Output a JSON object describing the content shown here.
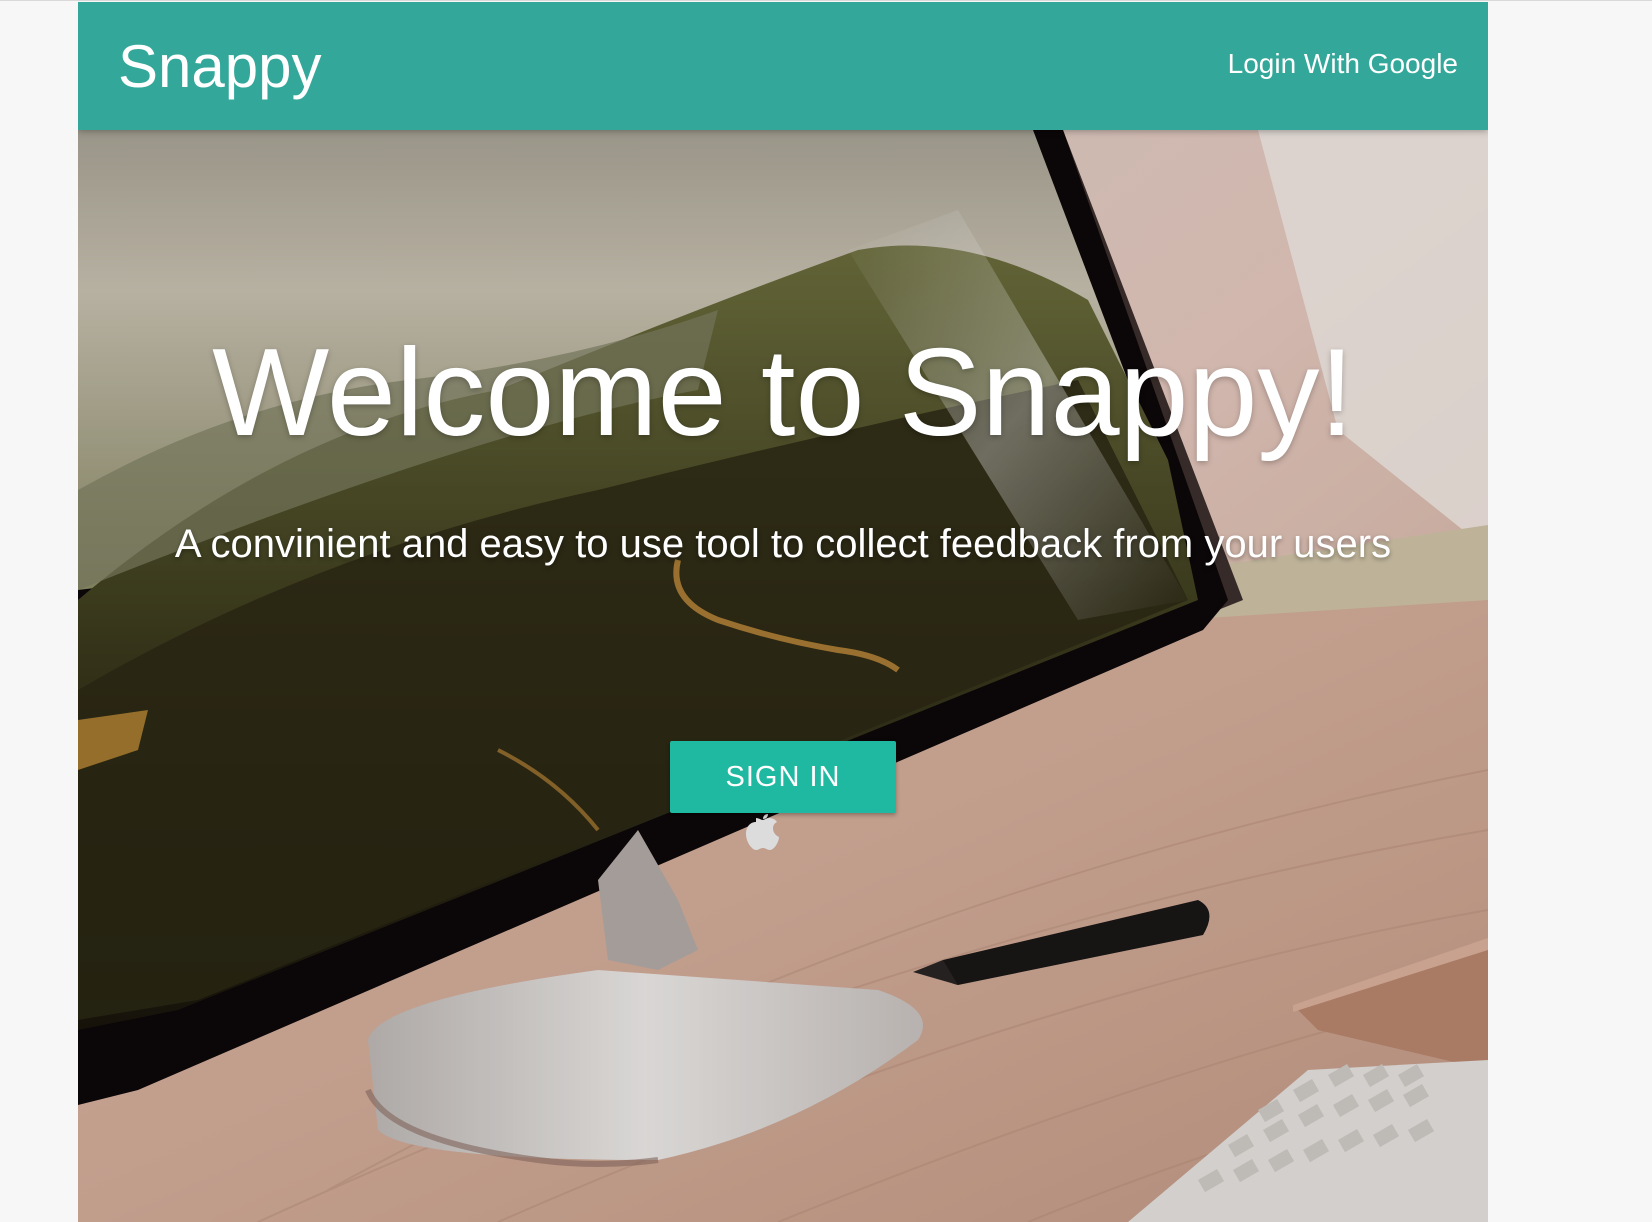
{
  "navbar": {
    "brand": "Snappy",
    "login_link": "Login With Google"
  },
  "hero": {
    "title": "Welcome to Snappy!",
    "subtitle": "A convinient and easy to use tool to collect feedback from your users",
    "cta_label": "SIGN IN"
  },
  "colors": {
    "navbar": "#33a89a",
    "button": "#1fb8a0"
  },
  "icons": {
    "apple_logo": "apple-logo-icon"
  }
}
